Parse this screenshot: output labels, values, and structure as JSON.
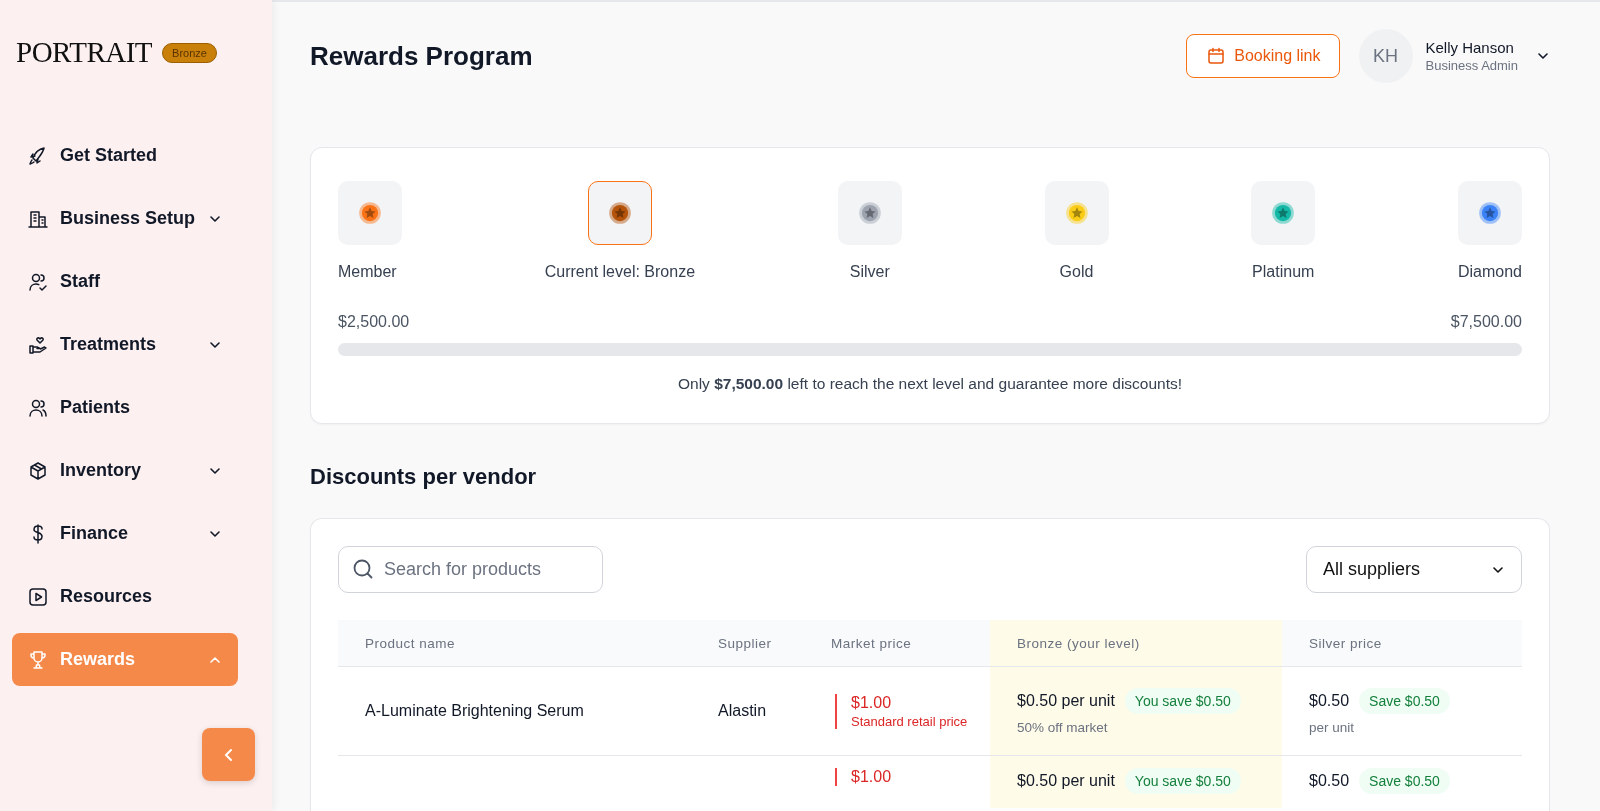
{
  "sidebar": {
    "logo": "PORTRAIT",
    "badge": "Bronze",
    "items": [
      {
        "label": "Get Started",
        "expandable": false,
        "expanded": false,
        "selected": false
      },
      {
        "label": "Business Setup",
        "expandable": true,
        "expanded": false,
        "selected": false
      },
      {
        "label": "Staff",
        "expandable": false,
        "expanded": false,
        "selected": false
      },
      {
        "label": "Treatments",
        "expandable": true,
        "expanded": false,
        "selected": false
      },
      {
        "label": "Patients",
        "expandable": false,
        "expanded": false,
        "selected": false
      },
      {
        "label": "Inventory",
        "expandable": true,
        "expanded": false,
        "selected": false
      },
      {
        "label": "Finance",
        "expandable": true,
        "expanded": false,
        "selected": false
      },
      {
        "label": "Resources",
        "expandable": false,
        "expanded": false,
        "selected": false
      },
      {
        "label": "Rewards",
        "expandable": true,
        "expanded": true,
        "selected": true
      }
    ]
  },
  "header": {
    "title": "Rewards Program",
    "booking_button": "Booking link",
    "user": {
      "initials": "KH",
      "name": "Kelly Hanson",
      "role": "Business Admin"
    }
  },
  "tiers": {
    "levels": [
      {
        "label": "Member",
        "color": "#f97316",
        "selected": false
      },
      {
        "label": "Current level: Bronze",
        "color": "#b45309",
        "selected": true
      },
      {
        "label": "Silver",
        "color": "#9ca3af",
        "selected": false
      },
      {
        "label": "Gold",
        "color": "#facc15",
        "selected": false
      },
      {
        "label": "Platinum",
        "color": "#14b8a6",
        "selected": false
      },
      {
        "label": "Diamond",
        "color": "#3b82f6",
        "selected": false
      }
    ],
    "min_amount": "$2,500.00",
    "max_amount": "$7,500.00",
    "progress": {
      "level": 0
    },
    "message": "Only **$7,500.00** left to reach the next level and guarantee more discounts!"
  },
  "discounts": {
    "heading": "Discounts per vendor",
    "search": {
      "placeholder": "Search for products"
    },
    "supplier_filter": "All suppliers",
    "columns": [
      "Product name",
      "Supplier",
      "Market price",
      "Bronze (your level)",
      "Silver price"
    ],
    "rows": [
      {
        "product": "A-Luminate Brightening Serum",
        "supplier": "Alastin",
        "market_price": "$1.00",
        "market_note": "Standard retail price",
        "bronze_price": "$0.50 per unit",
        "bronze_saving": "You save $0.50",
        "bronze_note": "50% off market",
        "silver_price": "$0.50",
        "silver_saving": "Save $0.50",
        "silver_note": "per unit"
      },
      {
        "market_price": "$1.00",
        "bronze_price": "$0.50 per unit",
        "bronze_saving": "You save $0.50",
        "silver_price": "$0.50",
        "silver_saving": "Save $0.50"
      }
    ]
  }
}
